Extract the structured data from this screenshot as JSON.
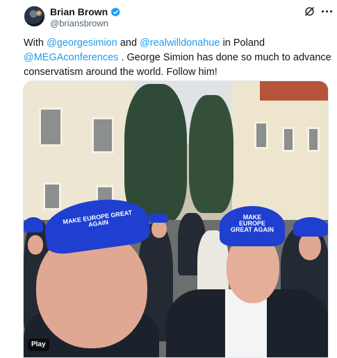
{
  "author": {
    "display_name": "Brian Brown",
    "handle": "@briansbrown"
  },
  "tweet": {
    "segments": [
      {
        "text": "With ",
        "type": "text"
      },
      {
        "text": "@georgesimion",
        "type": "mention"
      },
      {
        "text": " and ",
        "type": "text"
      },
      {
        "text": "@realwilldonahue",
        "type": "mention"
      },
      {
        "text": " in Poland ",
        "type": "text"
      },
      {
        "text": "@MEGAconferences",
        "type": "mention"
      },
      {
        "text": " .  George Simion has done so much to advance conservatism around the world. Follow him!",
        "type": "text"
      }
    ]
  },
  "media": {
    "badge": "Play",
    "cap_text": "MAKE EUROPE GREAT AGAIN"
  },
  "colors": {
    "mention": "#1d9bf0",
    "verified": "#1d9bf0",
    "cap": "#1f3fd0"
  },
  "icons": {
    "verified": "verified-badge-icon",
    "grok": "grok-icon",
    "more": "more-options-icon"
  }
}
